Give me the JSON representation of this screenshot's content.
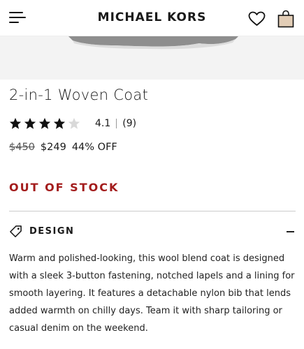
{
  "header": {
    "brand": "MICHAEL KORS",
    "icons": [
      "menu-icon",
      "heart-icon",
      "shopping-bag-icon"
    ]
  },
  "product": {
    "title": "2-in-1 Woven Coat",
    "rating": {
      "stars_filled": 4,
      "stars_total": 5,
      "value": "4.1",
      "count": "(9)"
    },
    "price": {
      "original": "$450",
      "sale": "$249",
      "discount": "44% OFF"
    },
    "stock_status": "OUT OF STOCK"
  },
  "design": {
    "label": "DESIGN",
    "expanded": true,
    "description": "Warm and polished-looking, this wool blend coat is designed with a sleek 3-button fastening, notched lapels and a lining for smooth layering. It features a detachable nylon bib that lends added warmth on chilly days. Team it with sharp tailoring or casual denim on the weekend."
  },
  "colors": {
    "stock_red": "#a31c1c",
    "bag_fill": "#e2cdb6"
  }
}
